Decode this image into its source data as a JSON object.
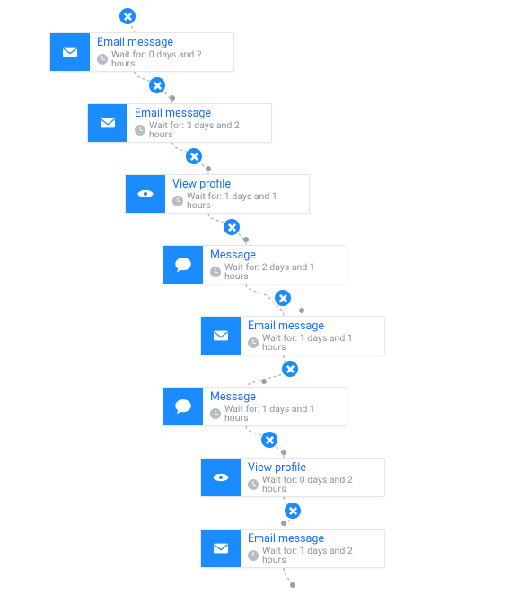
{
  "flow": {
    "accent_color": "#1a8cff",
    "link_color": "#1a6eff",
    "muted_color": "#8b9299",
    "steps": [
      {
        "id": 0,
        "type": "email",
        "icon": "envelope-icon",
        "title": "Email message",
        "wait": "Wait for: 0 days and 2 hours"
      },
      {
        "id": 1,
        "type": "email",
        "icon": "envelope-icon",
        "title": "Email message",
        "wait": "Wait for: 3 days and 2 hours"
      },
      {
        "id": 2,
        "type": "view",
        "icon": "eye-icon",
        "title": "View profile",
        "wait": "Wait for: 1 days and 1 hours"
      },
      {
        "id": 3,
        "type": "message",
        "icon": "chat-icon",
        "title": "Message",
        "wait": "Wait for: 2 days and 1 hours"
      },
      {
        "id": 4,
        "type": "email",
        "icon": "envelope-icon",
        "title": "Email message",
        "wait": "Wait for: 1 days and 1 hours"
      },
      {
        "id": 5,
        "type": "message",
        "icon": "chat-icon",
        "title": "Message",
        "wait": "Wait for: 1 days and 1 hours"
      },
      {
        "id": 6,
        "type": "view",
        "icon": "eye-icon",
        "title": "View profile",
        "wait": "Wait for: 0 days and 2 hours"
      },
      {
        "id": 7,
        "type": "email",
        "icon": "envelope-icon",
        "title": "Email message",
        "wait": "Wait for: 1 days and 2 hours"
      }
    ]
  }
}
